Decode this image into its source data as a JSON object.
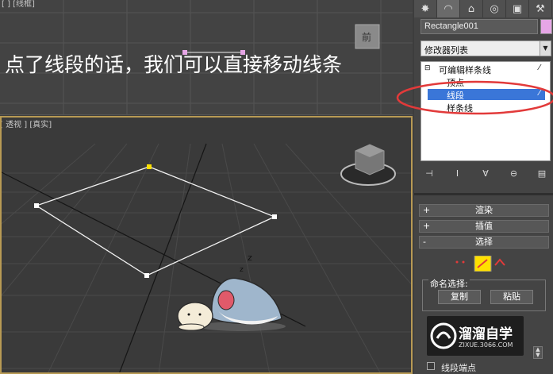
{
  "viewports": {
    "top_label": "[ ] [线框]",
    "persp_label": "[ 透视 ] [真实]",
    "viewcube_label": "前"
  },
  "subtitle": "点了线段的话，我们可以直接移动线条",
  "panel": {
    "tabs": [
      "create-icon",
      "modify-icon",
      "hierarchy-icon",
      "motion-icon",
      "display-icon",
      "utilities-icon"
    ],
    "object_name": "Rectangle001",
    "object_color": "#e6a6e6",
    "modifier_list": "修改器列表",
    "stack": {
      "root": "可编辑样条线",
      "items": [
        "顶点",
        "线段",
        "样条线"
      ],
      "selected": "线段"
    },
    "rollouts": {
      "render": "渲染",
      "interp": "插值",
      "selection": "选择"
    },
    "named_selection": {
      "title": "命名选择:",
      "copy": "复制",
      "paste": "粘贴"
    },
    "bottom_checkbox": "线段端点"
  },
  "watermark": {
    "name": "溜溜自学",
    "url": "ZIXUE.3066.COM"
  },
  "colors": {
    "accent_selected": "#3a76d8",
    "annotation": "#e23a3a",
    "viewport_active_border": "#b89a54"
  }
}
